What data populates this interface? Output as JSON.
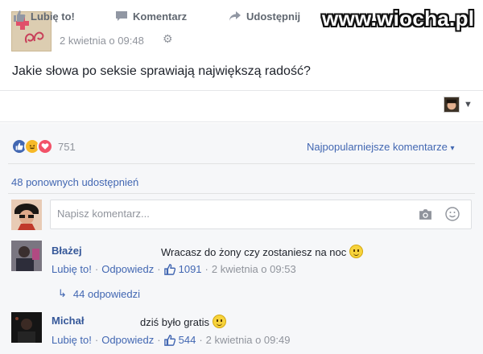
{
  "watermark": "www.wiocha.pl",
  "post": {
    "time": "2 kwietnia o 09:48",
    "text": "Jakie słowa po seksie sprawiają największą radość?"
  },
  "actions": {
    "like": "Lubię to!",
    "comment": "Komentarz",
    "share": "Udostępnij"
  },
  "summary": {
    "reaction_count": "751",
    "sort_label": "Najpopularniejsze komentarze",
    "shares": "48 ponownych udostępnień"
  },
  "comment_box": {
    "placeholder": "Napisz komentarz..."
  },
  "comments": [
    {
      "name": "Błażej",
      "text": "Wracasz do żony czy zostaniesz na noc",
      "like": "Lubię to!",
      "reply": "Odpowiedz",
      "likes": "1091",
      "time": "2 kwietnia o 09:53",
      "replies": "44 odpowiedzi"
    },
    {
      "name": "Michał",
      "text": "dziś było gratis",
      "like": "Lubię to!",
      "reply": "Odpowiedz",
      "likes": "544",
      "time": "2 kwietnia o 09:49"
    }
  ],
  "icons": {
    "like": "thumbs-up-icon",
    "comment": "speech-bubble-icon",
    "share": "share-arrow-icon",
    "camera": "camera-icon",
    "emoji": "smiley-icon",
    "gear": "gear-icon"
  },
  "colors": {
    "link": "#4267b2",
    "name": "#365899",
    "muted": "#90949c",
    "like_reaction": "#4267b2",
    "haha_reaction": "#f7b928",
    "love_reaction": "#f25268",
    "summary_bg": "#f6f7f9"
  }
}
